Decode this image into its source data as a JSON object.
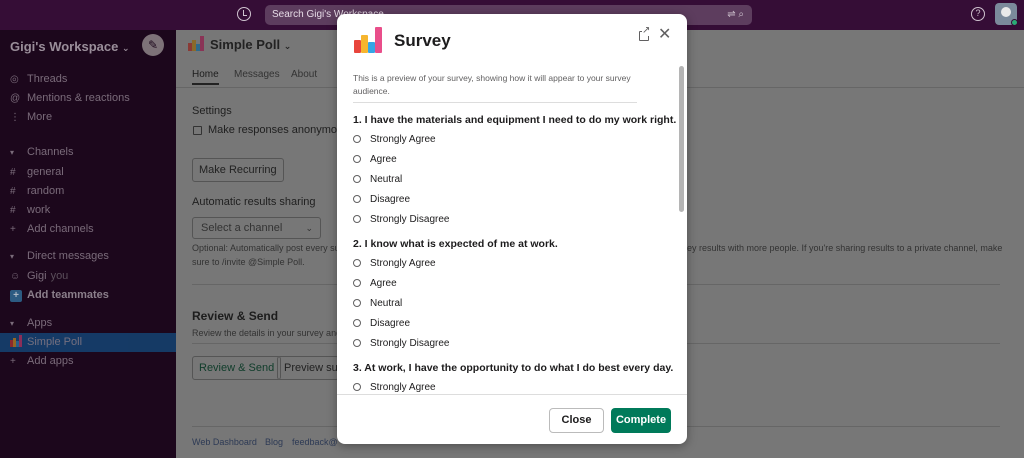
{
  "topbar": {
    "search_placeholder": "Search Gigi's Workspace",
    "search_filter_icon": "⇌ ⌕",
    "help_icon": "?"
  },
  "sidebar": {
    "workspace_name": "Gigi's Workspace",
    "compose_icon": "✎",
    "top_items": [
      {
        "icon": "◎",
        "label": "Threads"
      },
      {
        "icon": "@",
        "label": "Mentions & reactions"
      },
      {
        "icon": "⋮",
        "label": "More"
      }
    ],
    "channels_header": "Channels",
    "channels": [
      {
        "icon": "#",
        "label": "general"
      },
      {
        "icon": "#",
        "label": "random"
      },
      {
        "icon": "#",
        "label": "work"
      }
    ],
    "add_channels": "Add channels",
    "dm_header": "Direct messages",
    "dm_user": "Gigi",
    "dm_user_suffix": "you",
    "add_teammates": "Add teammates",
    "apps_header": "Apps",
    "app_active": "Simple Poll",
    "add_apps": "Add apps",
    "caret": "▾"
  },
  "main": {
    "title": "Simple Poll",
    "tabs": [
      "Home",
      "Messages",
      "About"
    ],
    "settings_label": "Settings",
    "anonymous_label": "Make responses anonymous",
    "make_recurring": "Make Recurring",
    "auto_sharing_label": "Automatic results sharing",
    "select_placeholder": "Select a channel",
    "optional_text_left": "Optional: Automatically post every su",
    "optional_text_right": "ey results with more people. If you're sharing results to a private channel, make",
    "optional_text_line2": "sure to /invite @Simple Poll.",
    "review_title": "Review & Send",
    "review_desc": "Review the details in your survey and",
    "review_send_btn": "Review & Send",
    "preview_btn": "Preview sur",
    "footer_links": [
      "Web Dashboard",
      "Blog",
      "feedback@"
    ]
  },
  "modal": {
    "title": "Survey",
    "preview_note": "This is a preview of your survey, showing how it will appear to your survey audience.",
    "questions": [
      {
        "text": "1. I have the materials and equipment I need to do my work right.",
        "options": [
          "Strongly Agree",
          "Agree",
          "Neutral",
          "Disagree",
          "Strongly Disagree"
        ]
      },
      {
        "text": "2. I know what is expected of me at work.",
        "options": [
          "Strongly Agree",
          "Agree",
          "Neutral",
          "Disagree",
          "Strongly Disagree"
        ]
      },
      {
        "text": "3. At work, I have the opportunity to do what I do best every day.",
        "options": [
          "Strongly Agree"
        ]
      }
    ],
    "close_label": "Close",
    "complete_label": "Complete",
    "close_icon": "✕"
  },
  "colors": {
    "topbar": "#350d36",
    "sidebar": "#1c071c",
    "active_item": "#1164a3",
    "complete_button": "#007a5a",
    "logo_red": "#e8453c",
    "logo_yellow": "#f6b52e",
    "logo_blue": "#35a5e6",
    "logo_pink": "#e94e8a"
  }
}
